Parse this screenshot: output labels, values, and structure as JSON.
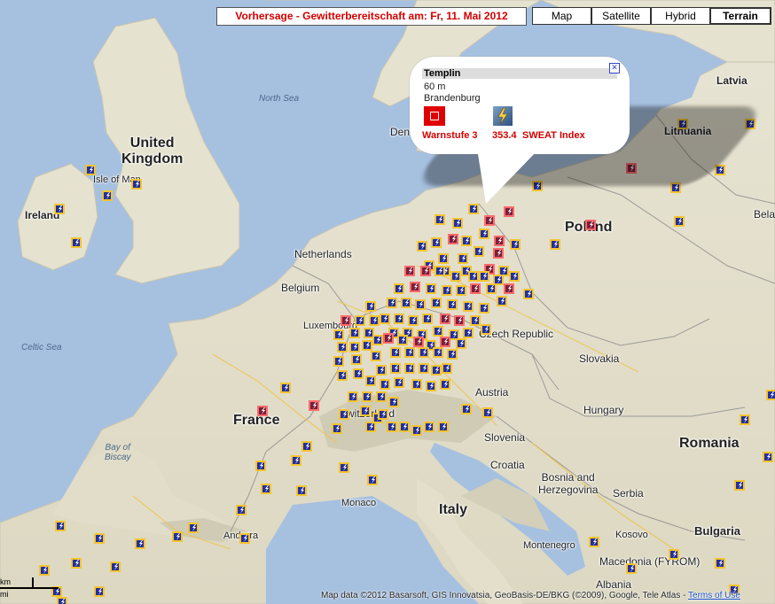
{
  "header": {
    "forecast_title": "Vorhersage - Gewitterbereitschaft am: Fr, 11. Mai 2012"
  },
  "map_types": [
    {
      "label": "Map",
      "active": false
    },
    {
      "label": "Satellite",
      "active": false
    },
    {
      "label": "Hybrid",
      "active": false
    },
    {
      "label": "Terrain",
      "active": true
    }
  ],
  "labels": {
    "north_sea": "North Sea",
    "celtic_sea": "Celtic Sea",
    "bay_of_biscay": "Bay of\nBiscay",
    "united_kingdom": "United\nKingdom",
    "isle_of_man": "Isle of Man",
    "ireland": "Ireland",
    "netherlands": "Netherlands",
    "belgium": "Belgium",
    "luxembourg": "Luxembourg",
    "france": "France",
    "switzerland": "Switzerland",
    "monaco": "Monaco",
    "andorra": "Andorra",
    "italy": "Italy",
    "austria": "Austria",
    "slovenia": "Slovenia",
    "croatia": "Croatia",
    "bosnia": "Bosnia and\nHerzegovina",
    "serbia": "Serbia",
    "montenegro": "Montenegro",
    "kosovo": "Kosovo",
    "macedonia": "Macedonia (FYROM)",
    "albania": "Albania",
    "bulgaria": "Bulgaria",
    "romania": "Romania",
    "hungary": "Hungary",
    "slovakia": "Slovakia",
    "czech": "Czech Republic",
    "poland": "Poland",
    "lithuania": "Lithuania",
    "latvia": "Latvia",
    "belarus": "Bela",
    "denmark": "Den"
  },
  "popup": {
    "place": "Templin",
    "elevation": "60 m",
    "region": "Brandenburg",
    "warn_label": "Warnstufe 3",
    "sweat_value": "353.4",
    "sweat_label": "SWEAT Index",
    "close_icon": "close-icon"
  },
  "attribution": {
    "text": "Map data ©2012 Basarsoft, GIS Innovatsia, GeoBasis-DE/BKG (©2009), Google, Tele Atlas - ",
    "terms": "Terms of Use"
  },
  "scale": {
    "km": "km",
    "mi": "mi"
  },
  "colors": {
    "title_red": "#d40000",
    "marker_fill": "#25309a",
    "marker_border": "#f4c430",
    "warn_border": "#ff6b6b",
    "warn_fill": "#7a1f3a"
  }
}
